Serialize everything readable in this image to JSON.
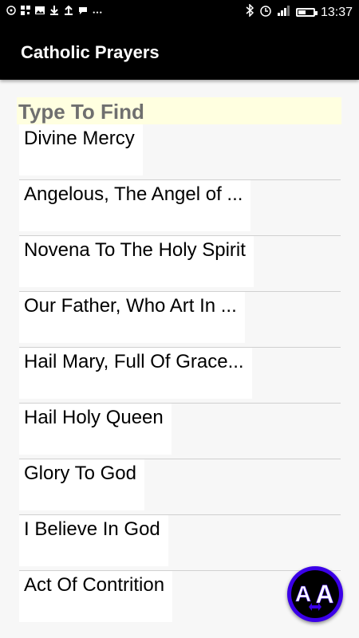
{
  "status_bar": {
    "time": "13:37",
    "left_icons": [
      "whatsapp-icon",
      "qr-icon",
      "image-icon",
      "download-icon",
      "upload-icon",
      "chat-icon",
      "more-icon"
    ],
    "battery_level": 0.5
  },
  "app_bar": {
    "title": "Catholic Prayers"
  },
  "search": {
    "placeholder": "Type To Find"
  },
  "prayers": [
    "Divine Mercy",
    "Angelous, The Angel of ...",
    "Novena To The Holy Spirit",
    "Our Father, Who Art In ...",
    "Hail Mary, Full Of Grace...",
    "Hail Holy Queen",
    "Glory To God",
    "I Believe In God",
    "Act Of Contrition"
  ],
  "fab": {
    "icon": "text-size-icon",
    "letters": [
      "A",
      "A"
    ]
  },
  "colors": {
    "status_bar": "#000000",
    "app_bar": "#000000",
    "search_bg": "#ffffe0",
    "fab": "#3b00e8"
  }
}
